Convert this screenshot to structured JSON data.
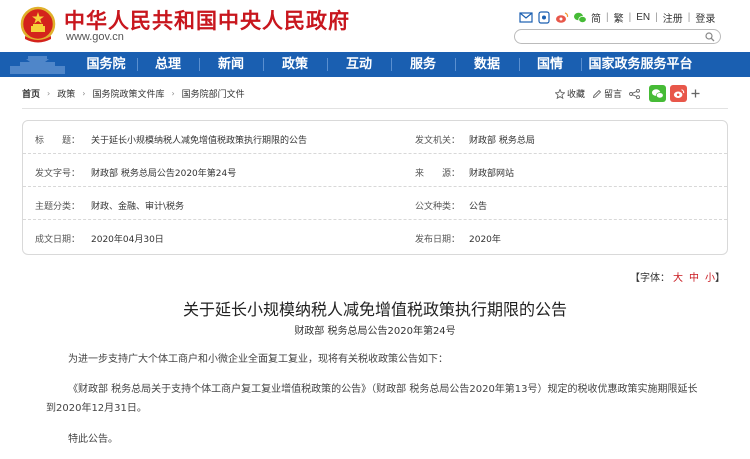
{
  "header": {
    "site_title": "中华人民共和国中央人民政府",
    "site_url": "www.gov.cn",
    "top_links": [
      "简",
      "繁",
      "EN",
      "注册",
      "登录"
    ],
    "search_placeholder": ""
  },
  "nav": {
    "items": [
      "国务院",
      "总理",
      "新闻",
      "政策",
      "互动",
      "服务",
      "数据",
      "国情",
      "国家政务服务平台"
    ],
    "bg_color": "#1a5fb1"
  },
  "breadcrumb": [
    "首页",
    "政策",
    "国务院政策文件库",
    "国务院部门文件"
  ],
  "tools": {
    "favorite": "收藏",
    "comment": "留言"
  },
  "info": {
    "title_label": "标　　题：",
    "title_value": "关于延长小规模纳税人减免增值税政策执行期限的公告",
    "issuer_label": "发文机关：",
    "issuer_value": "财政部 税务总局",
    "docno_label": "发文字号：",
    "docno_value": "财政部 税务总局公告2020年第24号",
    "source_label": "来　　源：",
    "source_value": "财政部网站",
    "topic_label": "主题分类：",
    "topic_value": "财政、金融、审计\\税务",
    "doctype_label": "公文种类：",
    "doctype_value": "公告",
    "created_label": "成文日期：",
    "created_value": "2020年04月30日",
    "published_label": "发布日期：",
    "published_value": "2020年"
  },
  "font_control": {
    "label": "【字体：",
    "large": "大",
    "medium": "中",
    "small": "小",
    "close": "】"
  },
  "article": {
    "title": "关于延长小规模纳税人减免增值税政策执行期限的公告",
    "subtitle": "财政部 税务总局公告2020年第24号",
    "p1": "为进一步支持广大个体工商户和小微企业全面复工复业，现将有关税收政策公告如下：",
    "p2": "《财政部 税务总局关于支持个体工商户复工复业增值税政策的公告》（财政部 税务总局公告2020年第13号）规定的税收优惠政策实施期限延长到2020年12月31日。",
    "p3": "特此公告。"
  },
  "colors": {
    "brand_red": "#c8161d",
    "nav_blue": "#1a5fb1",
    "wechat_green": "#46bb36",
    "weibo_red": "#e8574a"
  }
}
